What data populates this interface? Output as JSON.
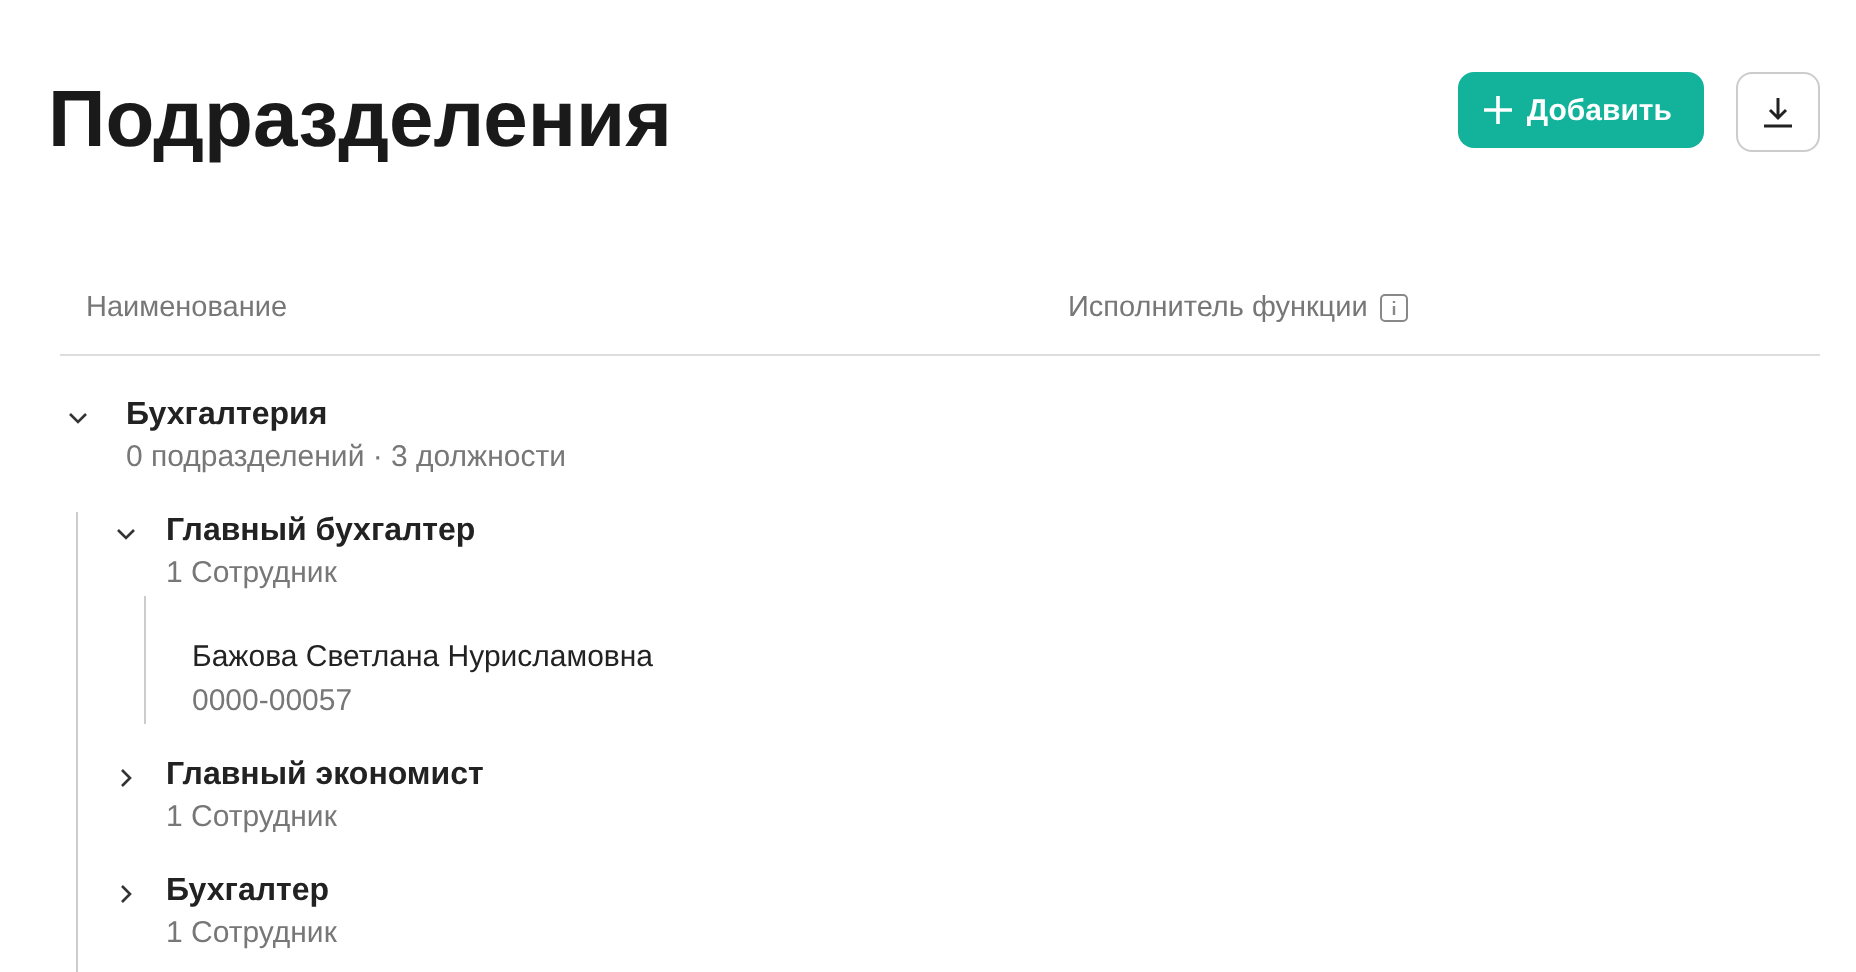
{
  "title": "Подразделения",
  "add_button": "Добавить",
  "columns": [
    "Наименование",
    "Исполнитель функции"
  ],
  "tree": [
    {
      "name": "Бухгалтерия",
      "subtitle": "0 подразделений · 3 должности",
      "expanded": true,
      "children": [
        {
          "name": "Главный бухгалтер",
          "subtitle": "1 Сотрудник",
          "expanded": true,
          "employees": [
            {
              "name": "Бажова Светлана Нурисламовна",
              "code": "0000-00057"
            }
          ]
        },
        {
          "name": "Главный экономист",
          "subtitle": "1 Сотрудник",
          "expanded": false
        },
        {
          "name": "Бухгалтер",
          "subtitle": "1 Сотрудник",
          "expanded": false
        }
      ]
    }
  ]
}
